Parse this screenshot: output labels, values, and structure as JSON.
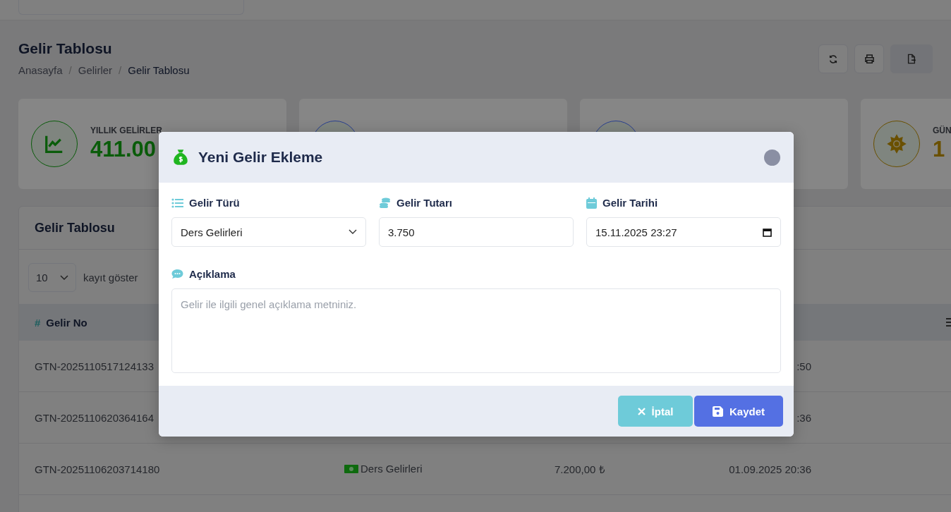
{
  "page": {
    "title": "Gelir Tablosu",
    "breadcrumb": [
      {
        "label": "Anasayfa",
        "selected": false
      },
      {
        "separator": "/",
        "label": "Gelirler",
        "selected": false
      },
      {
        "separator": "/",
        "label": "Gelir Tablosu",
        "selected": true
      }
    ]
  },
  "stats": [
    {
      "kind": "chart",
      "label": "YILLIK GELİRLER",
      "value": "411.00",
      "color": "#0a5c0a"
    },
    {
      "kind": "plain",
      "color": "#2a4090"
    },
    {
      "kind": "plain",
      "color": "#2a4090"
    },
    {
      "kind": "sun",
      "label": "GÜN",
      "value": "1",
      "color": "#6a5000"
    }
  ],
  "table": {
    "title": "Gelir Tablosu",
    "page_length": "10",
    "page_length_label": "kayıt göster",
    "columns": [
      {
        "icon": "#",
        "label": "Gelir No"
      }
    ],
    "rows": [
      {
        "no": "GTN-2025110517124133",
        "date": ":50"
      },
      {
        "no": "GTN-2025110620364164",
        "date": ":36"
      },
      {
        "no": "GTN-20251106203714180",
        "type": "Ders Gelirleri",
        "amount": "7.200,00 ₺",
        "date": "01.09.2025 20:36"
      }
    ]
  },
  "modal": {
    "title": "Yeni Gelir Ekleme",
    "fields": [
      {
        "kind": "select",
        "label": "Gelir Türü",
        "value": "Ders Gelirleri"
      },
      {
        "kind": "text",
        "label": "Gelir Tutarı",
        "value": "3.750"
      },
      {
        "kind": "datetime",
        "label": "Gelir Tarihi",
        "value": "15.11.2025 23:27"
      }
    ],
    "description": {
      "label": "Açıklama",
      "placeholder": "Gelir ile ilgili genel açıklama metniniz."
    },
    "buttons": [
      {
        "kind": "cancel",
        "label": "İptal"
      },
      {
        "kind": "save",
        "label": "Kaydet"
      }
    ]
  }
}
